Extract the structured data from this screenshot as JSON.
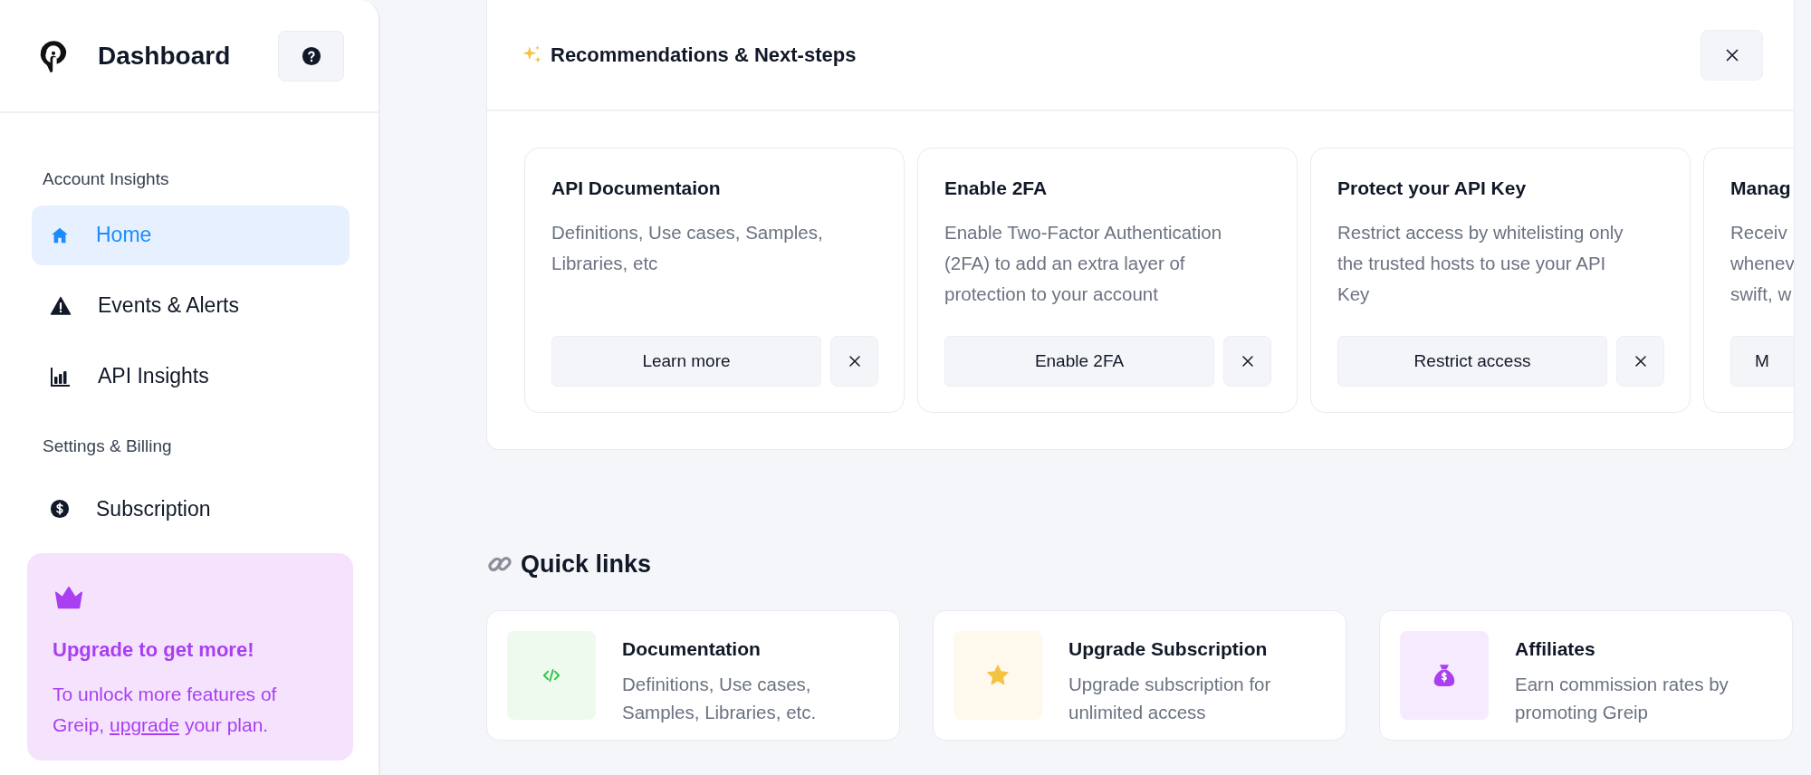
{
  "sidebar": {
    "title": "Dashboard",
    "sections": [
      {
        "heading": "Account Insights",
        "items": [
          {
            "label": "Home",
            "selected": true
          },
          {
            "label": "Events & Alerts",
            "selected": false
          },
          {
            "label": "API Insights",
            "selected": false
          }
        ]
      },
      {
        "heading": "Settings & Billing",
        "items": [
          {
            "label": "Subscription",
            "selected": false
          }
        ]
      }
    ],
    "upgrade": {
      "title": "Upgrade to get more!",
      "text_before": "To unlock more features of Greip, ",
      "link": "upgrade",
      "text_after": " your plan."
    }
  },
  "recommendations": {
    "title": "Recommendations & Next-steps",
    "cards": [
      {
        "title": "API Documentaion",
        "description_lines": [
          "Definitions, Use cases, Samples,",
          "Libraries, etc"
        ],
        "button": "Learn more"
      },
      {
        "title": "Enable 2FA",
        "description_lines": [
          "Enable Two-Factor Authentication",
          "(2FA) to add an extra layer of",
          "protection to your account"
        ],
        "button": "Enable 2FA"
      },
      {
        "title": "Protect your API Key",
        "description_lines": [
          "Restrict access by whitelisting only",
          "the trusted hosts to use your API",
          "Key"
        ],
        "button": "Restrict access"
      },
      {
        "title": "Manag",
        "description_lines": [
          "Receiv",
          "whenev",
          "swift, w"
        ],
        "button": "M"
      }
    ]
  },
  "quick_links": {
    "title": "Quick links",
    "items": [
      {
        "title": "Documentation",
        "description_lines": [
          "Definitions, Use cases,",
          "Samples, Libraries, etc."
        ]
      },
      {
        "title": "Upgrade Subscription",
        "description_lines": [
          "Upgrade subscription for",
          "unlimited access"
        ]
      },
      {
        "title": "Affiliates",
        "description_lines": [
          "Earn commission rates by",
          "promoting Greip"
        ]
      }
    ]
  }
}
